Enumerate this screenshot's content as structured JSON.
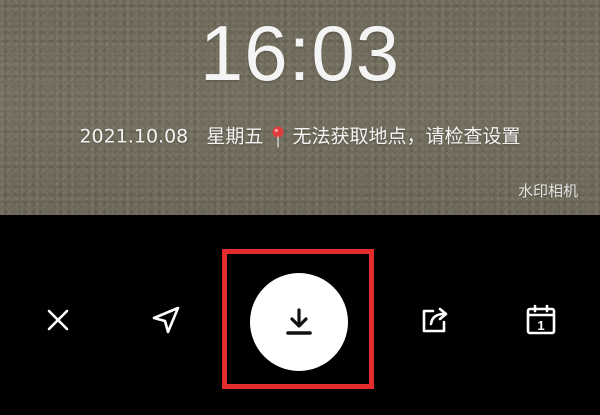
{
  "watermark": {
    "time": "16:03",
    "date": "2021.10.08",
    "weekday": "星期五",
    "location_message": "无法获取地点，请检查设置",
    "brand": "水印相机"
  },
  "toolbar": {
    "icons": [
      "close-icon",
      "navigation-arrow-icon",
      "download-icon",
      "share-icon",
      "calendar-icon"
    ],
    "calendar_day": "1",
    "highlight_color": "#e52b2b",
    "pin_color": "#e23b3b"
  }
}
